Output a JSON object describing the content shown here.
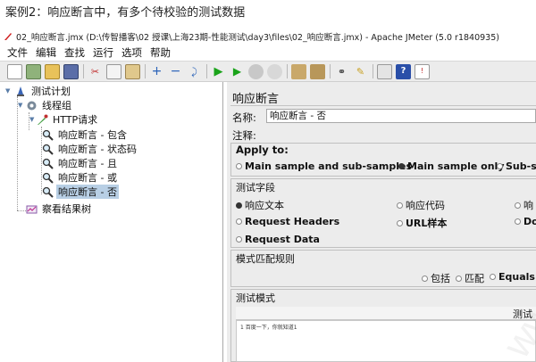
{
  "caption": "案例2：响应断言中，有多个待校验的测试数据",
  "window": {
    "title": "02_响应断言.jmx (D:\\传智播客\\02 授课\\上海23期-性能测试\\day3\\files\\02_响应断言.jmx) - Apache JMeter (5.0 r1840935)"
  },
  "menu": [
    "文件",
    "编辑",
    "查找",
    "运行",
    "选项",
    "帮助"
  ],
  "toolbar": {
    "icons": [
      "new-icon",
      "templates-icon",
      "open-icon",
      "save-icon",
      "cut-icon",
      "copy-icon",
      "paste-icon",
      "expand-icon",
      "collapse-icon",
      "toggle-icon",
      "start-icon",
      "start-no-pause-icon",
      "stop-icon",
      "shutdown-icon",
      "clear-icon",
      "clear-all-icon",
      "search-icon",
      "reset-search-icon",
      "function-helper-icon",
      "help-icon",
      "log-icon"
    ]
  },
  "tree": {
    "items": [
      {
        "label": "测试计划"
      },
      {
        "label": "线程组"
      },
      {
        "label": "HTTP请求"
      },
      {
        "label": "响应断言 - 包含"
      },
      {
        "label": "响应断言 - 状态码"
      },
      {
        "label": "响应断言 - 且"
      },
      {
        "label": "响应断言 - 或"
      },
      {
        "label": "响应断言 - 否"
      },
      {
        "label": "察看结果树"
      }
    ]
  },
  "panel": {
    "title": "响应断言",
    "name_label": "名称:",
    "name_value": "响应断言 - 否",
    "comment_label": "注释:",
    "comment_value": "",
    "apply_to": {
      "title": "Apply to:",
      "options": [
        "Main sample and sub-samples",
        "Main sample only",
        "Sub-s"
      ],
      "selected": "Main sample only"
    },
    "test_field": {
      "title": "测试字段",
      "options": [
        "响应文本",
        "响应代码",
        "响",
        "Request Headers",
        "URL样本",
        "Do",
        "Request Data"
      ],
      "selected": "响应文本"
    },
    "pattern_rules": {
      "title": "模式匹配规则",
      "options": [
        "包括",
        "匹配",
        "Equals"
      ]
    },
    "test_patterns": {
      "title": "测试模式",
      "column_header": "测试",
      "rows": [
        "1  百度一下，你就知道1"
      ]
    }
  },
  "watermark": "www.itheima.com",
  "colors": {
    "selection": "#b8cfe5",
    "panel_bg": "#ececec",
    "start_green": "#1aa31a"
  }
}
